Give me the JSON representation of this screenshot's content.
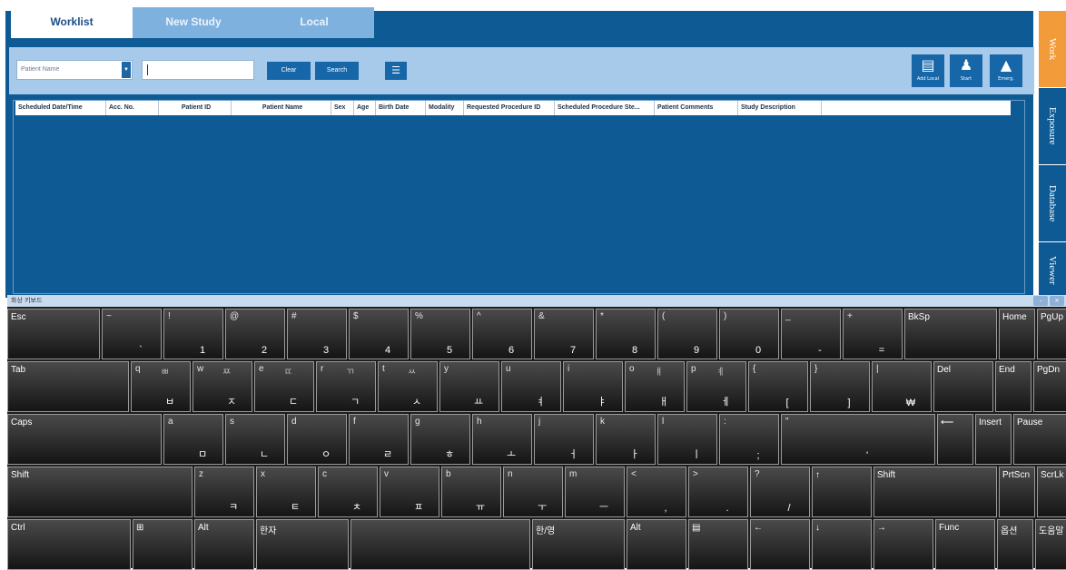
{
  "tabs": [
    {
      "label": "Worklist"
    },
    {
      "label": "New Study"
    },
    {
      "label": "Local"
    }
  ],
  "toolbar": {
    "search_field_selected": "Patient Name",
    "search_text": "",
    "clear_label": "Clear",
    "search_label": "Search",
    "add_local_label": "Add Local",
    "start_label": "Start",
    "emerg_label": "Emerg."
  },
  "grid": {
    "columns": [
      "Scheduled Date/Time",
      "Acc. No.",
      "Patient ID",
      "Patient Name",
      "Sex",
      "Age",
      "Birth Date",
      "Modality",
      "Requested Procedure ID",
      "Scheduled Procedure Ste...",
      "Patient Comments",
      "Study Description",
      ""
    ]
  },
  "side_tabs": [
    {
      "label": "Work"
    },
    {
      "label": "Exposure"
    },
    {
      "label": "Database"
    },
    {
      "label": "Viewer"
    }
  ],
  "keyboard": {
    "title": "화상 키보드",
    "rows": [
      [
        {
          "label": "Esc"
        },
        {
          "top": "~",
          "bottom": "`"
        },
        {
          "top": "!",
          "bottom": "1"
        },
        {
          "top": "@",
          "bottom": "2"
        },
        {
          "top": "#",
          "bottom": "3"
        },
        {
          "top": "$",
          "bottom": "4"
        },
        {
          "top": "%",
          "bottom": "5"
        },
        {
          "top": "^",
          "bottom": "6"
        },
        {
          "top": "&",
          "bottom": "7"
        },
        {
          "top": "*",
          "bottom": "8"
        },
        {
          "top": "(",
          "bottom": "9"
        },
        {
          "top": ")",
          "bottom": "0"
        },
        {
          "top": "_",
          "bottom": "-"
        },
        {
          "top": "+",
          "bottom": "="
        },
        {
          "label": "BkSp"
        },
        {
          "label": "Home"
        },
        {
          "label": "PgUp"
        }
      ],
      [
        {
          "label": "Tab"
        },
        {
          "top": "q",
          "alt": "ㅃ",
          "bottom": "ㅂ"
        },
        {
          "top": "w",
          "alt": "ㅉ",
          "bottom": "ㅈ"
        },
        {
          "top": "e",
          "alt": "ㄸ",
          "bottom": "ㄷ"
        },
        {
          "top": "r",
          "alt": "ㄲ",
          "bottom": "ㄱ"
        },
        {
          "top": "t",
          "alt": "ㅆ",
          "bottom": "ㅅ"
        },
        {
          "top": "y",
          "bottom": "ㅛ"
        },
        {
          "top": "u",
          "bottom": "ㅕ"
        },
        {
          "top": "i",
          "bottom": "ㅑ"
        },
        {
          "top": "o",
          "alt": "ㅒ",
          "bottom": "ㅐ"
        },
        {
          "top": "p",
          "alt": "ㅖ",
          "bottom": "ㅔ"
        },
        {
          "top": "{",
          "bottom": "["
        },
        {
          "top": "}",
          "bottom": "]"
        },
        {
          "top": "|",
          "bottom": "₩"
        },
        {
          "label": "Del"
        },
        {
          "label": "End"
        },
        {
          "label": "PgDn"
        }
      ],
      [
        {
          "label": "Caps"
        },
        {
          "top": "a",
          "bottom": "ㅁ"
        },
        {
          "top": "s",
          "bottom": "ㄴ"
        },
        {
          "top": "d",
          "bottom": "ㅇ"
        },
        {
          "top": "f",
          "bottom": "ㄹ"
        },
        {
          "top": "g",
          "bottom": "ㅎ"
        },
        {
          "top": "h",
          "bottom": "ㅗ"
        },
        {
          "top": "j",
          "bottom": "ㅓ"
        },
        {
          "top": "k",
          "bottom": "ㅏ"
        },
        {
          "top": "l",
          "bottom": "ㅣ"
        },
        {
          "top": ":",
          "bottom": ";"
        },
        {
          "top": "\"",
          "bottom": "'"
        },
        {
          "label": "⟵"
        },
        {
          "label": "Insert"
        },
        {
          "label": "Pause"
        }
      ],
      [
        {
          "label": "Shift"
        },
        {
          "top": "z",
          "bottom": "ㅋ"
        },
        {
          "top": "x",
          "bottom": "ㅌ"
        },
        {
          "top": "c",
          "bottom": "ㅊ"
        },
        {
          "top": "v",
          "bottom": "ㅍ"
        },
        {
          "top": "b",
          "bottom": "ㅠ"
        },
        {
          "top": "n",
          "bottom": "ㅜ"
        },
        {
          "top": "m",
          "bottom": "ㅡ"
        },
        {
          "top": "<",
          "bottom": ","
        },
        {
          "top": ">",
          "bottom": "."
        },
        {
          "top": "?",
          "bottom": "/"
        },
        {
          "label": "↑"
        },
        {
          "label": "Shift"
        },
        {
          "label": "PrtScn"
        },
        {
          "label": "ScrLk"
        }
      ],
      [
        {
          "label": "Ctrl"
        },
        {
          "label": "⊞"
        },
        {
          "label": "Alt"
        },
        {
          "label": "한자"
        },
        {
          "label": ""
        },
        {
          "label": "한/영"
        },
        {
          "label": "Alt"
        },
        {
          "label": "▤"
        },
        {
          "label": "←"
        },
        {
          "label": "↓"
        },
        {
          "label": "→"
        },
        {
          "label": "Func"
        },
        {
          "label": "옵션"
        },
        {
          "label": "도움말"
        }
      ]
    ]
  }
}
